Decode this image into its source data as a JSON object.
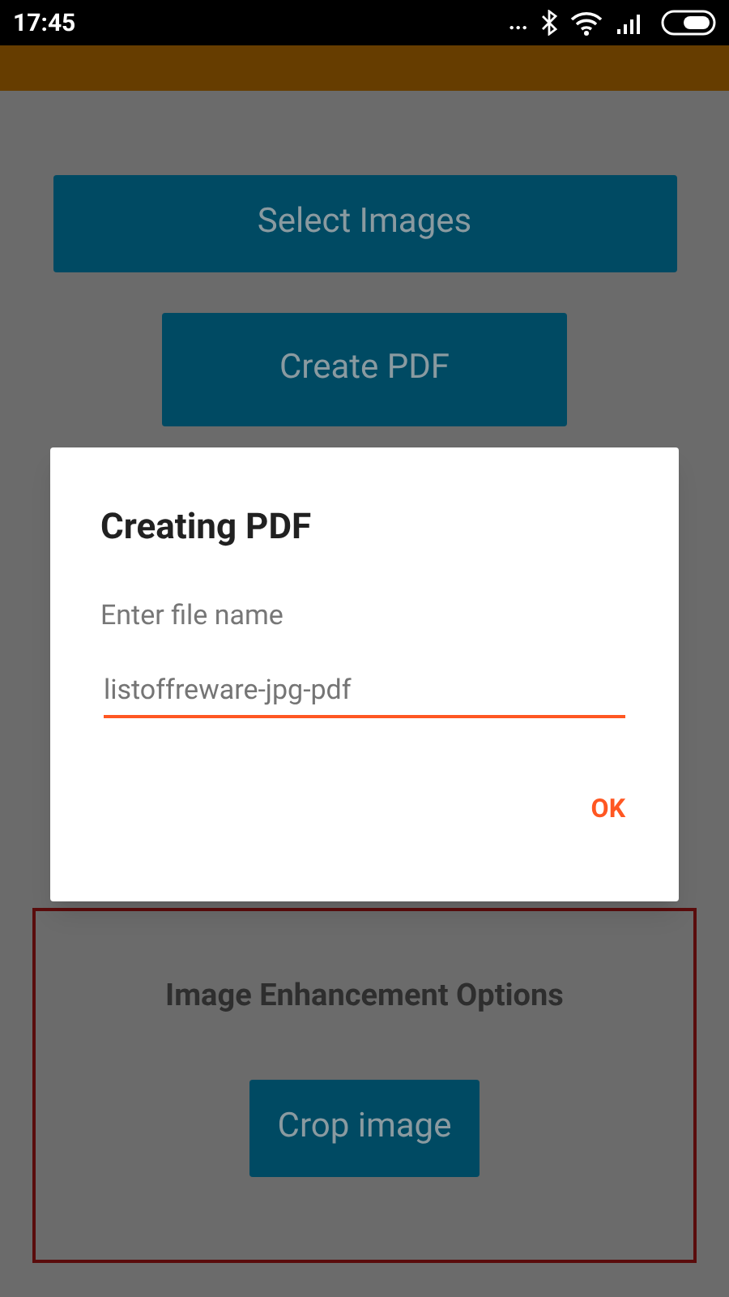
{
  "status_bar": {
    "time": "17:45",
    "more": "..."
  },
  "buttons": [
    {
      "label": "Select Images"
    },
    {
      "label": "Create PDF"
    }
  ],
  "enhancement": {
    "title": "Image Enhancement Options",
    "button": "Crop image"
  },
  "dialog": {
    "title": "Creating PDF",
    "message": "Enter file name",
    "value": "listoffreware-jpg-pdf",
    "action": "OK"
  }
}
